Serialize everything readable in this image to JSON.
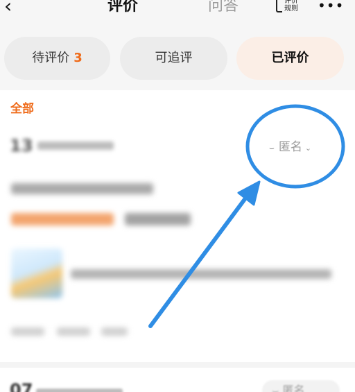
{
  "header": {
    "back_icon": "back-arrow-icon",
    "tabs": [
      "评价",
      "问答"
    ],
    "rules_label": "评价规则",
    "more_icon": "more-icon"
  },
  "filters": {
    "pending_label": "待评价",
    "pending_count": "3",
    "followup_label": "可追评",
    "done_label": "已评价"
  },
  "review": {
    "section_label": "全部",
    "anonymous_label": "匿名",
    "anonymous_icon": "closed-eye-icon",
    "date_day": "13"
  },
  "review2": {
    "date_day": "07",
    "anonymous_label": "匿名"
  },
  "colors": {
    "accent": "#ef6b1a",
    "annotation": "#2f8de4",
    "selected_pill_bg": "#fbeee6"
  }
}
